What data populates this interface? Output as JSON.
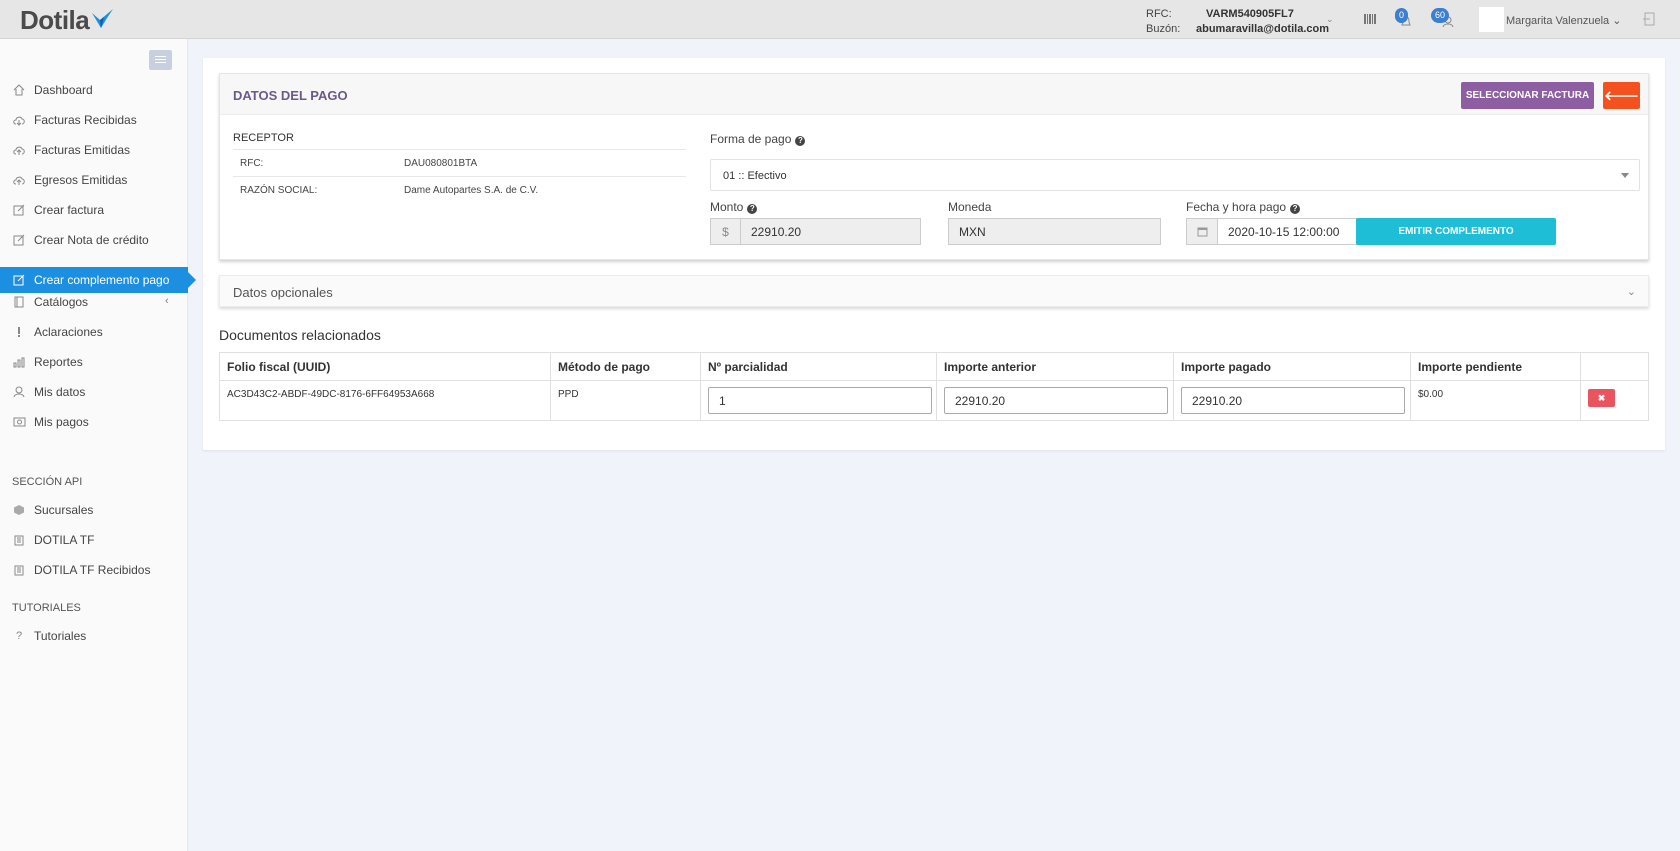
{
  "app": {
    "logo_text": "Dotila",
    "brand_color": "#1d8fe1"
  },
  "header": {
    "rfc_label": "RFC:",
    "rfc_value": "VARM540905FL7",
    "buzon_label": "Buzón:",
    "buzon_value": "abumaravilla@dotila.com",
    "notif_badge_1": "0",
    "notif_badge_2": "60",
    "user_name": "Margarita Valenzuela",
    "user_caret": "⌄"
  },
  "sidebar": {
    "items": [
      {
        "label": "Dashboard",
        "icon": "home-icon"
      },
      {
        "label": "Facturas Recibidas",
        "icon": "cloud-download-icon"
      },
      {
        "label": "Facturas Emitidas",
        "icon": "cloud-upload-icon"
      },
      {
        "label": "Egresos Emitidas",
        "icon": "cloud-upload-icon"
      },
      {
        "label": "Crear factura",
        "icon": "edit-icon"
      },
      {
        "label": "Crear Nota de crédito",
        "icon": "edit-icon"
      },
      {
        "label": "Crear complemento pago",
        "icon": "edit-icon",
        "active": true
      },
      {
        "label": "Catálogos",
        "icon": "book-icon"
      },
      {
        "label": "Aclaraciones",
        "icon": "exclamation-icon"
      },
      {
        "label": "Reportes",
        "icon": "bar-chart-icon"
      },
      {
        "label": "Mis datos",
        "icon": "user-icon"
      },
      {
        "label": "Mis pagos",
        "icon": "money-icon"
      }
    ],
    "section_api": "SECCIÓN API",
    "api_items": [
      {
        "label": "Sucursales",
        "icon": "cube-icon"
      },
      {
        "label": "DOTILA TF",
        "icon": "barcode-icon"
      },
      {
        "label": "DOTILA TF Recibidos",
        "icon": "barcode-icon"
      }
    ],
    "section_tutoriales": "TUTORIALES",
    "tutorial_items": [
      {
        "label": "Tutoriales",
        "icon": "question-icon"
      }
    ],
    "catalogos_chevron": "‹"
  },
  "pago": {
    "title": "DATOS DEL PAGO",
    "select_button": "SELECCIONAR FACTURA",
    "back_button": "🡐",
    "receptor_title": "RECEPTOR",
    "rfc_key": "RFC:",
    "rfc_val": "DAU080801BTA",
    "razon_key": "RAZÓN SOCIAL:",
    "razon_val": "Dame Autopartes S.A. de C.V.",
    "forma_label": "Forma de pago",
    "forma_value": "01 :: Efectivo",
    "monto_label": "Monto",
    "monto_addon": "$",
    "monto_value": "22910.20",
    "moneda_label": "Moneda",
    "moneda_value": "MXN",
    "fecha_label": "Fecha y hora pago",
    "fecha_value": "2020-10-15 12:00:00",
    "emit_button": "EMITIR COMPLEMENTO",
    "help_glyph": "?"
  },
  "opcionales": {
    "title": "Datos opcionales",
    "chevron": "⌄"
  },
  "docs": {
    "title": "Documentos relacionados",
    "columns": [
      "Folio fiscal (UUID)",
      "Método de pago",
      "Nº parcialidad",
      "Importe anterior",
      "Importe pagado",
      "Importe pendiente",
      ""
    ],
    "rows": [
      {
        "uuid": "AC3D43C2-ABDF-49DC-8176-6FF64953A668",
        "metodo": "PPD",
        "parcialidad": "1",
        "importe_anterior": "22910.20",
        "importe_pagado": "22910.20",
        "importe_pendiente": "$0.00",
        "delete": "✖"
      }
    ]
  }
}
